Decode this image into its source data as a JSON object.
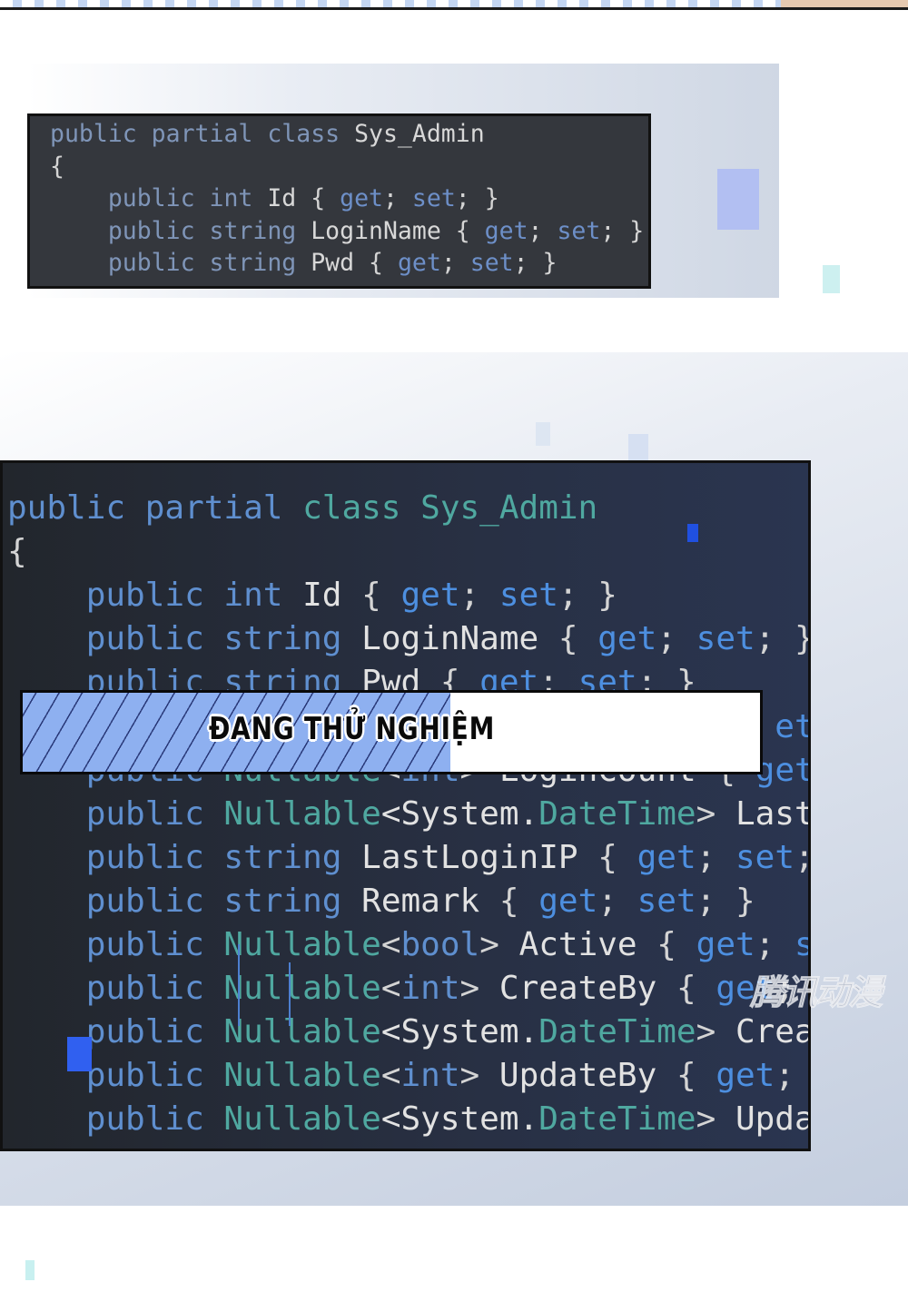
{
  "panel1": {
    "code": [
      [
        [
          "public partial ",
          "k"
        ],
        [
          "class ",
          "t"
        ],
        [
          "Sys_Admin",
          "n"
        ]
      ],
      [
        [
          "{",
          "p"
        ]
      ],
      [
        [
          "    public int ",
          "k"
        ],
        [
          "Id ",
          "n"
        ],
        [
          "{ ",
          "p"
        ],
        [
          "get",
          "a"
        ],
        [
          "; ",
          "p"
        ],
        [
          "set",
          "a"
        ],
        [
          "; }",
          "p"
        ]
      ],
      [
        [
          "    public string ",
          "k"
        ],
        [
          "LoginName ",
          "n"
        ],
        [
          "{ ",
          "p"
        ],
        [
          "get",
          "a"
        ],
        [
          "; ",
          "p"
        ],
        [
          "set",
          "a"
        ],
        [
          "; }",
          "p"
        ]
      ],
      [
        [
          "    public string ",
          "k"
        ],
        [
          "Pwd ",
          "n"
        ],
        [
          "{ ",
          "p"
        ],
        [
          "get",
          "a"
        ],
        [
          "; ",
          "p"
        ],
        [
          "set",
          "a"
        ],
        [
          "; }",
          "p"
        ]
      ]
    ]
  },
  "panel2": {
    "code": [
      [
        [
          "public partial ",
          "k"
        ],
        [
          "class ",
          "t"
        ],
        [
          "Sys_Admin",
          "t"
        ]
      ],
      [
        [
          "{",
          "p"
        ]
      ],
      [
        [
          "    public int ",
          "k"
        ],
        [
          "Id ",
          "n"
        ],
        [
          "{ ",
          "p"
        ],
        [
          "get",
          "a"
        ],
        [
          "; ",
          "p"
        ],
        [
          "set",
          "a"
        ],
        [
          "; }",
          "p"
        ]
      ],
      [
        [
          "    public string ",
          "k"
        ],
        [
          "LoginName ",
          "n"
        ],
        [
          "{ ",
          "p"
        ],
        [
          "get",
          "a"
        ],
        [
          "; ",
          "p"
        ],
        [
          "set",
          "a"
        ],
        [
          "; }",
          "p"
        ]
      ],
      [
        [
          "    public string ",
          "k"
        ],
        [
          "Pwd ",
          "n"
        ],
        [
          "{ ",
          "p"
        ],
        [
          "get",
          "a"
        ],
        [
          "; ",
          "p"
        ],
        [
          "set",
          "a"
        ],
        [
          "; }",
          "p"
        ]
      ],
      [
        [
          "                                       ",
          "p"
        ],
        [
          "et;",
          "a"
        ]
      ],
      [
        [
          "    public ",
          "k"
        ],
        [
          "Nullable",
          "t"
        ],
        [
          "<",
          "p"
        ],
        [
          "int",
          "k"
        ],
        [
          "> ",
          "p"
        ],
        [
          "LoginCount ",
          "n"
        ],
        [
          "{ ",
          "p"
        ],
        [
          "get",
          "a"
        ]
      ],
      [
        [
          "    public ",
          "k"
        ],
        [
          "Nullable",
          "t"
        ],
        [
          "<System.",
          "n"
        ],
        [
          "DateTime",
          "t"
        ],
        [
          "> ",
          "p"
        ],
        [
          "Last",
          "n"
        ]
      ],
      [
        [
          "    public string ",
          "k"
        ],
        [
          "LastLoginIP ",
          "n"
        ],
        [
          "{ ",
          "p"
        ],
        [
          "get",
          "a"
        ],
        [
          "; ",
          "p"
        ],
        [
          "set",
          "a"
        ],
        [
          ";",
          "p"
        ]
      ],
      [
        [
          "    public string ",
          "k"
        ],
        [
          "Remark ",
          "n"
        ],
        [
          "{ ",
          "p"
        ],
        [
          "get",
          "a"
        ],
        [
          "; ",
          "p"
        ],
        [
          "set",
          "a"
        ],
        [
          "; }",
          "p"
        ]
      ],
      [
        [
          "    public ",
          "k"
        ],
        [
          "Nullable",
          "t"
        ],
        [
          "<",
          "p"
        ],
        [
          "bool",
          "k"
        ],
        [
          "> ",
          "p"
        ],
        [
          "Active ",
          "n"
        ],
        [
          "{ ",
          "p"
        ],
        [
          "get",
          "a"
        ],
        [
          "; ",
          "p"
        ],
        [
          "s",
          "a"
        ]
      ],
      [
        [
          "    public ",
          "k"
        ],
        [
          "Nullable",
          "t"
        ],
        [
          "<",
          "p"
        ],
        [
          "int",
          "k"
        ],
        [
          "> ",
          "p"
        ],
        [
          "CreateBy ",
          "n"
        ],
        [
          "{ ",
          "p"
        ],
        [
          "get",
          "a"
        ],
        [
          ";",
          "p"
        ]
      ],
      [
        [
          "    public ",
          "k"
        ],
        [
          "Nullable",
          "t"
        ],
        [
          "<System.",
          "n"
        ],
        [
          "DateTime",
          "t"
        ],
        [
          "> ",
          "p"
        ],
        [
          "Crea",
          "n"
        ]
      ],
      [
        [
          "    public ",
          "k"
        ],
        [
          "Nullable",
          "t"
        ],
        [
          "<",
          "p"
        ],
        [
          "int",
          "k"
        ],
        [
          "> ",
          "p"
        ],
        [
          "UpdateBy ",
          "n"
        ],
        [
          "{ ",
          "p"
        ],
        [
          "get",
          "a"
        ],
        [
          ";",
          "p"
        ]
      ],
      [
        [
          "    public ",
          "k"
        ],
        [
          "Nullable",
          "t"
        ],
        [
          "<System.",
          "n"
        ],
        [
          "DateTime",
          "t"
        ],
        [
          "> ",
          "p"
        ],
        [
          "Upda",
          "n"
        ]
      ]
    ]
  },
  "banner": {
    "text": "ĐANG THỬ NGHIỆM",
    "progress_percent": 58,
    "fill_color": "#8eb0f0"
  },
  "watermark": "腾讯动漫",
  "colors": {
    "keyword": "#5f8fcf",
    "type": "#4fa8a0",
    "identifier": "#e2e2e2",
    "accessor": "#4d8fe0",
    "code_background": "#2c2f35"
  }
}
